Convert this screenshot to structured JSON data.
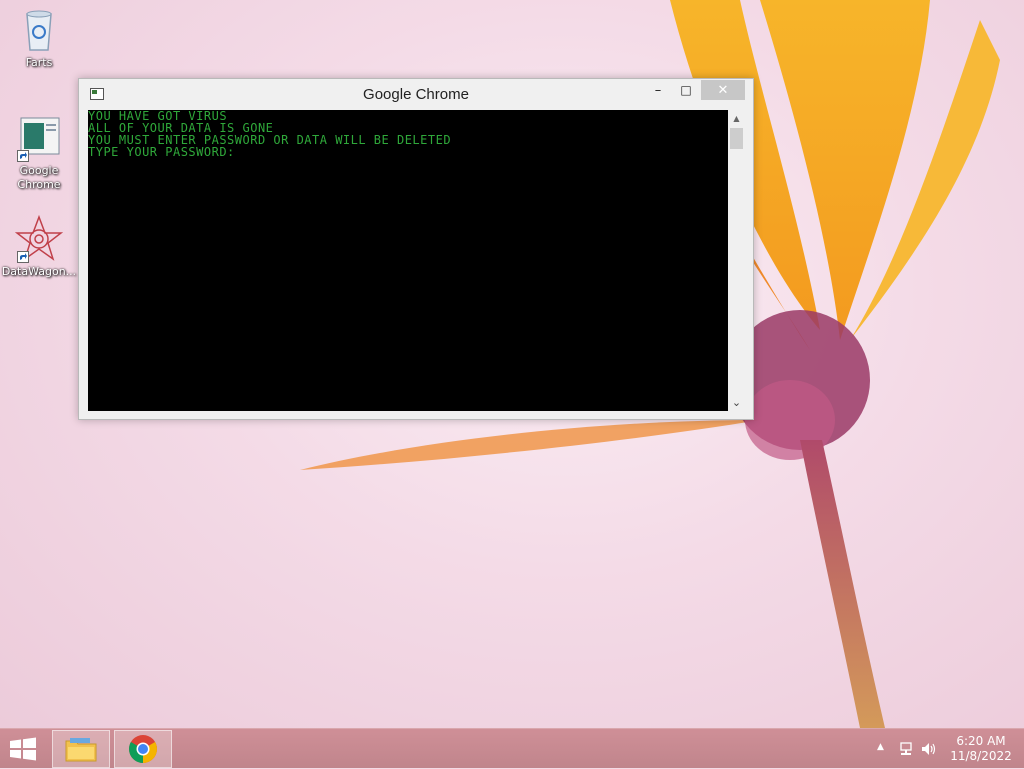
{
  "desktop": {
    "icons": [
      {
        "label": "Farts",
        "icon": "recycle-bin-icon"
      },
      {
        "label": "Google Chrome",
        "icon": "console-app-icon"
      },
      {
        "label": "DataWagon...",
        "icon": "datawagon-icon"
      }
    ]
  },
  "window": {
    "title": "Google Chrome",
    "minimize_glyph": "–",
    "maximize_glyph": "□",
    "close_glyph": "✕",
    "console_lines": [
      "YOU HAVE GOT VIRUS",
      "ALL OF YOUR DATA IS GONE",
      "YOU MUST ENTER PASSWORD OR DATA WILL BE DELETED",
      "TYPE YOUR PASSWORD:"
    ],
    "text_color": "#2fa83a",
    "background_color": "#000000"
  },
  "taskbar": {
    "start_icon": "windows-logo-icon",
    "pinned": [
      {
        "name": "File Explorer",
        "icon": "file-explorer-icon"
      },
      {
        "name": "Google Chrome",
        "icon": "chrome-icon"
      }
    ],
    "tray": {
      "arrow_glyph": "▲",
      "time": "6:20 AM",
      "date": "11/8/2022"
    },
    "color": "#c8878f"
  }
}
